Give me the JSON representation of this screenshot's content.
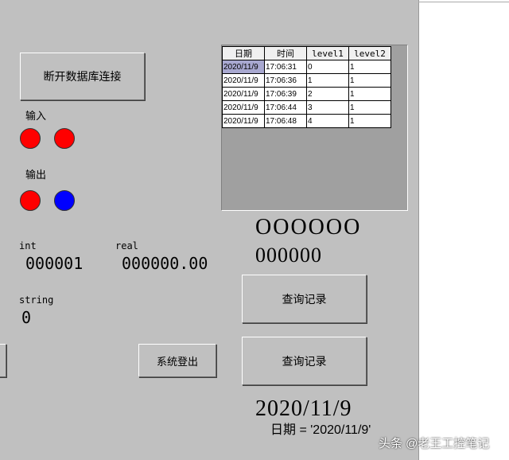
{
  "buttons": {
    "disconnect": "断开数据库连接",
    "logout": "系统登出",
    "query1": "查询记录",
    "query2": "查询记录"
  },
  "input_label": "输入",
  "output_label": "输出",
  "colors": {
    "red": "#ff0000",
    "blue": "#0000ff"
  },
  "table": {
    "headers": [
      "日期",
      "时间",
      "level1",
      "level2"
    ],
    "rows": [
      [
        "2020/11/9",
        "17:06:31",
        "0",
        "1"
      ],
      [
        "2020/11/9",
        "17:06:36",
        "1",
        "1"
      ],
      [
        "2020/11/9",
        "17:06:39",
        "2",
        "1"
      ],
      [
        "2020/11/9",
        "17:06:44",
        "3",
        "1"
      ],
      [
        "2020/11/9",
        "17:06:48",
        "4",
        "1"
      ]
    ]
  },
  "int_label": "int",
  "int_value": "000001",
  "real_label": "real",
  "real_value": "000000.00",
  "string_label": "string",
  "string_value": "0",
  "display1": "OOOOOO",
  "display2": "000000",
  "date_big": "2020/11/9",
  "date_query": "日期 = '2020/11/9'",
  "watermark": "头条 @老王工控笔记"
}
